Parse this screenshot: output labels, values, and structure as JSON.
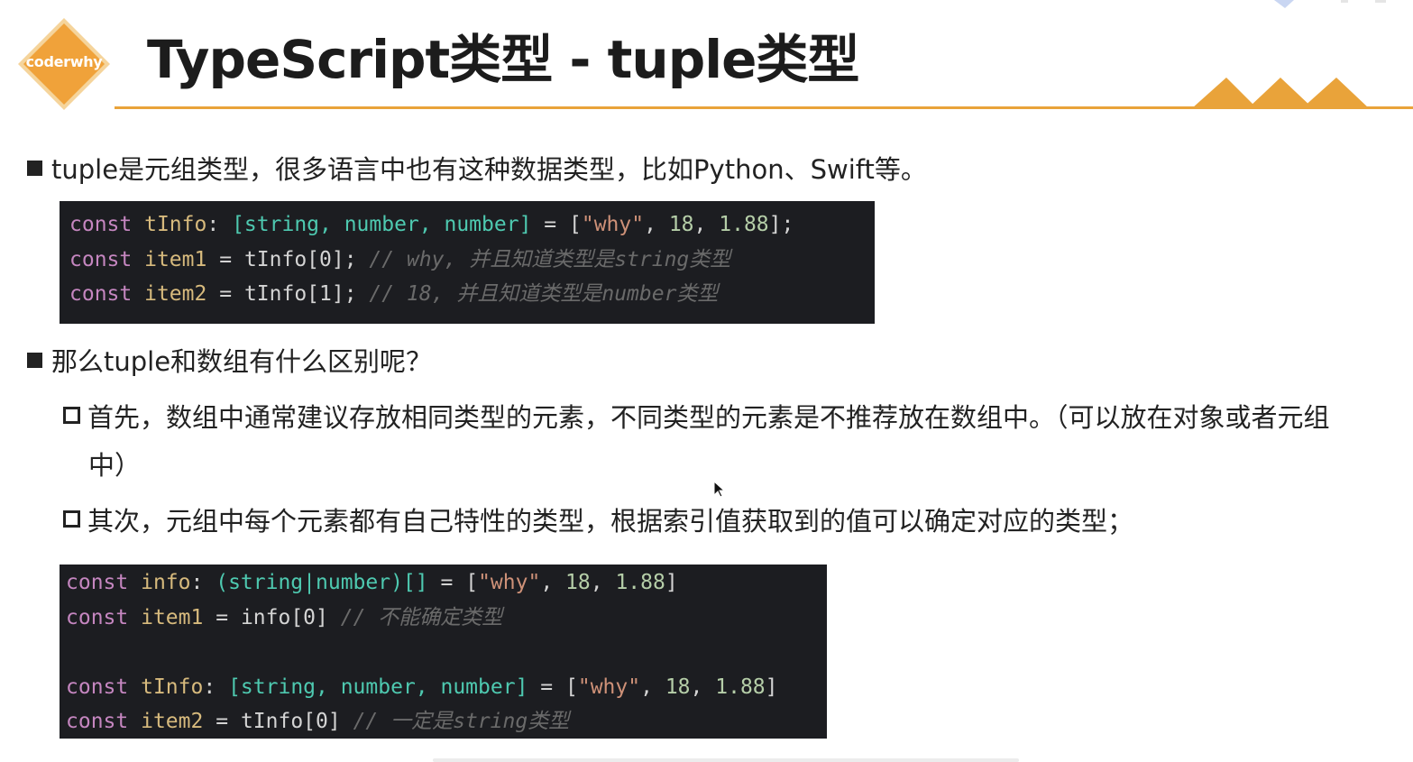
{
  "logo": {
    "text": "coderwhy",
    "color": "#f0a23a"
  },
  "title": "TypeScript类型 - tuple类型",
  "accent_color": "#e9a33a",
  "bullets": {
    "b1": "tuple是元组类型，很多语言中也有这种数据类型，比如Python、Swift等。",
    "b2": "那么tuple和数组有什么区别呢？",
    "s1_line1": "首先，数组中通常建议存放相同类型的元素，不同类型的元素是不推荐放在数组中。（可以放在对象或者元组",
    "s1_line2": "中）",
    "s2": "其次，元组中每个元素都有自己特性的类型，根据索引值获取到的值可以确定对应的类型；"
  },
  "code1": {
    "l1": {
      "kw": "const",
      "name": "tInfo",
      "colon": ":",
      "type": "[string, number, number]",
      "eq": "=",
      "value_open": "[",
      "s1": "\"why\"",
      "sep1": ",",
      "n1": "18",
      "sep2": ",",
      "n2": "1.88",
      "value_close": "];"
    },
    "l2": {
      "kw": "const",
      "name": "item1",
      "eq": "=",
      "rhs": "tInfo[0];",
      "comment": "// why, 并且知道类型是string类型"
    },
    "l3": {
      "kw": "const",
      "name": "item2",
      "eq": "=",
      "rhs": "tInfo[1];",
      "comment": "// 18, 并且知道类型是number类型"
    }
  },
  "code2": {
    "l1": {
      "kw": "const",
      "name": "info",
      "colon": ":",
      "type": "(string|number)[]",
      "eq": "=",
      "value_open": "[",
      "s1": "\"why\"",
      "sep1": ",",
      "n1": "18",
      "sep2": ",",
      "n2": "1.88",
      "value_close": "]"
    },
    "l2": {
      "kw": "const",
      "name": "item1",
      "eq": "=",
      "rhs": "info[0]",
      "comment": "// 不能确定类型"
    },
    "l4": {
      "kw": "const",
      "name": "tInfo",
      "colon": ":",
      "type": "[string, number, number]",
      "eq": "=",
      "value_open": "[",
      "s1": "\"why\"",
      "sep1": ",",
      "n1": "18",
      "sep2": ",",
      "n2": "1.88",
      "value_close": "]"
    },
    "l5": {
      "kw": "const",
      "name": "item2",
      "eq": "=",
      "rhs": "tInfo[0]",
      "comment": "// 一定是string类型"
    }
  }
}
